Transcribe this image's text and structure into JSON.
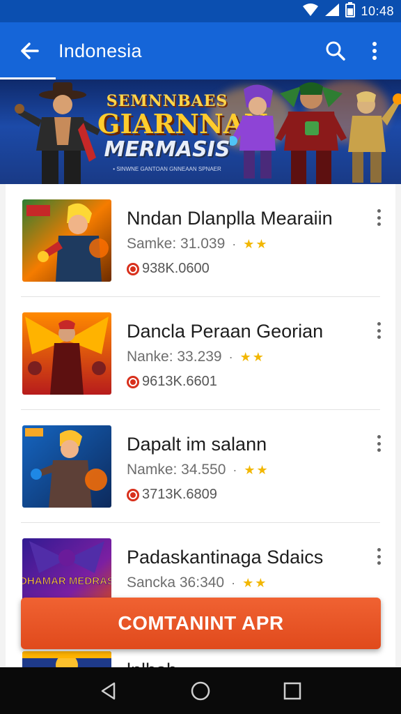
{
  "status_bar": {
    "time": "10:48",
    "icons": [
      "wifi-icon",
      "signal-icon",
      "battery-icon"
    ]
  },
  "app_bar": {
    "title": "Indonesia",
    "back_icon": "arrow-back-icon",
    "search_icon": "search-icon",
    "more_icon": "more-vert-icon"
  },
  "banner": {
    "line1": "SEMNNBAES",
    "line2": "GIARNNAN",
    "line3": "MERMASIS",
    "line4": "• SINWNE GANTOAN GNNEAAN SPNAER"
  },
  "items": [
    {
      "title": "Nndan Dlanplla Mearaiin",
      "subtitle": "Samke: 31.039",
      "stars": "★★",
      "meta": "938K.0600",
      "thumb_theme": "orange-hero"
    },
    {
      "title": "Dancla Peraan Georian",
      "subtitle": "Nanke: 33.239",
      "stars": "★★",
      "meta": "9613K.6601",
      "thumb_theme": "red-wings"
    },
    {
      "title": "Dapalt im salann",
      "subtitle": "Namke: 34.550",
      "stars": "★★",
      "meta": "3713K.6809",
      "thumb_theme": "blue-warrior"
    },
    {
      "title": "Padaskantinaga Sdaics",
      "subtitle": "Sancka 36:340",
      "stars": "★★",
      "meta": "",
      "thumb_theme": "purple-dragon",
      "thumb_text": "DHAMAR MEDRAS"
    },
    {
      "title": "lnlhah",
      "subtitle": "",
      "stars": "",
      "meta": "",
      "thumb_theme": "gold-partial"
    }
  ],
  "cta": {
    "label": "COMTANINT APR"
  },
  "nav_bar": {
    "back_icon": "nav-back-icon",
    "home_icon": "nav-home-icon",
    "recents_icon": "nav-recents-icon"
  },
  "colors": {
    "app_bar": "#1565d8",
    "status_bar": "#0b4fb0",
    "cta": "#e8521f",
    "star": "#f2b701"
  }
}
